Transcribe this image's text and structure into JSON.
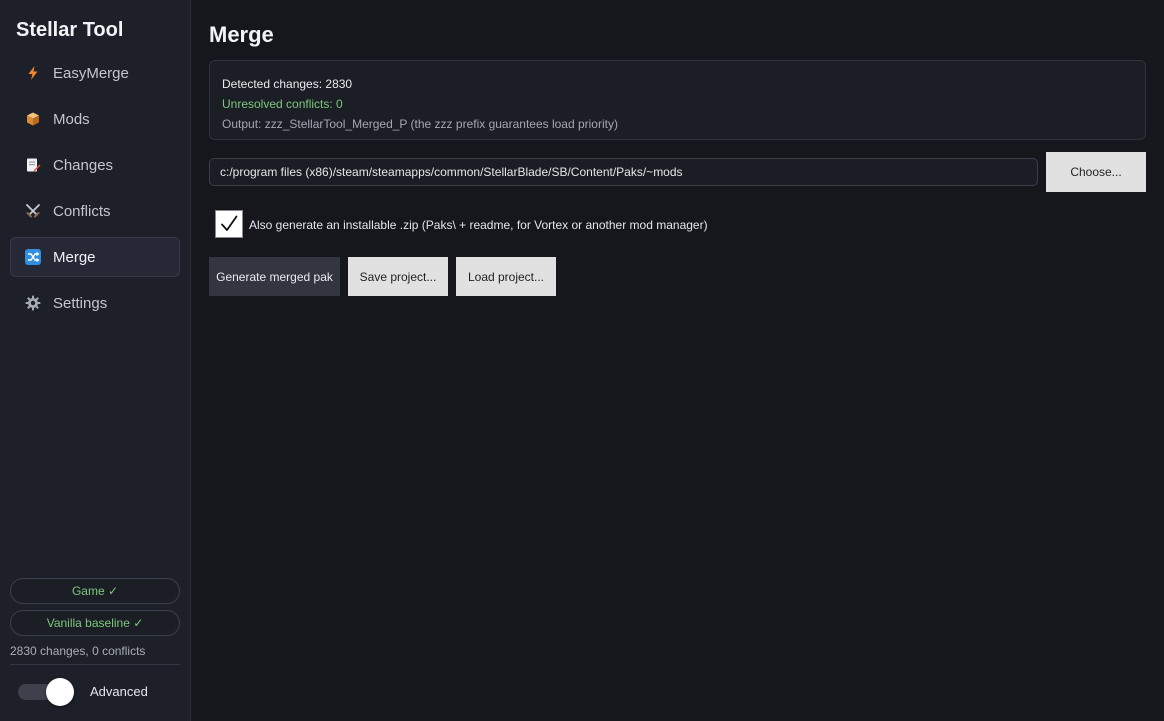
{
  "app": {
    "title": "Stellar Tool"
  },
  "sidebar": {
    "items": [
      {
        "label": "EasyMerge",
        "icon": "lightning-icon"
      },
      {
        "label": "Mods",
        "icon": "package-icon"
      },
      {
        "label": "Changes",
        "icon": "document-edit-icon"
      },
      {
        "label": "Conflicts",
        "icon": "crossed-swords-icon"
      },
      {
        "label": "Merge",
        "icon": "shuffle-icon",
        "active": true
      },
      {
        "label": "Settings",
        "icon": "gear-icon"
      }
    ],
    "status": {
      "game": "Game ✓",
      "vanilla": "Vanilla baseline ✓",
      "summary": "2830 changes, 0 conflicts"
    },
    "advanced": {
      "label": "Advanced",
      "enabled": true
    }
  },
  "main": {
    "title": "Merge",
    "info": {
      "detected": "Detected changes: 2830",
      "unresolved": "Unresolved conflicts: 0",
      "output": "Output: zzz_StellarTool_Merged_P (the zzz prefix guarantees load priority)"
    },
    "path": {
      "value": "c:/program files (x86)/steam/steamapps/common/StellarBlade/SB/Content/Paks/~mods",
      "choose_label": "Choose..."
    },
    "zip_option": {
      "checked": true,
      "label": "Also generate an installable .zip (Paks\\ + readme, for Vortex or another mod manager)"
    },
    "actions": {
      "generate": "Generate merged pak",
      "save": "Save project...",
      "load": "Load project..."
    }
  },
  "colors": {
    "background": "#16171c",
    "sidebar": "#1e2029",
    "success": "#7cc77d",
    "light_button": "#e1e1e1"
  }
}
